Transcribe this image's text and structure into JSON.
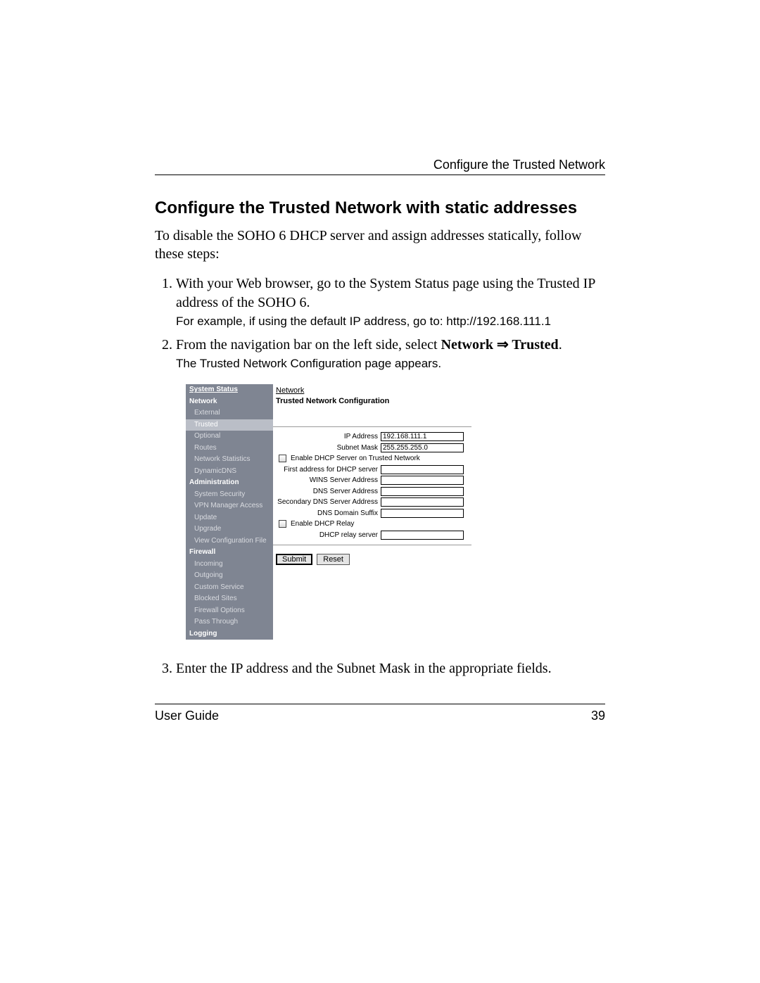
{
  "running_head": "Configure the Trusted Network",
  "section_title": "Configure the Trusted Network with static addresses",
  "intro": "To disable the SOHO 6 DHCP server and assign addresses statically, follow these steps:",
  "steps": {
    "1": {
      "main": "With your Web browser, go to the System Status page using the Trusted IP address of the SOHO 6.",
      "sub": "For example, if using the default IP address, go to: http://192.168.111.1"
    },
    "2": {
      "main_pre": "From the navigation bar on the left side, select ",
      "path": "Network ⇒ Trusted",
      "path_suffix": ".",
      "sub": "The Trusted Network Configuration page appears."
    },
    "3": {
      "main": "Enter the IP address and the Subnet Mask in the appropriate fields."
    }
  },
  "screenshot": {
    "sidebar": [
      {
        "label": "System Status",
        "type": "hdr",
        "underline": true
      },
      {
        "label": "Network",
        "type": "hdr"
      },
      {
        "label": "External",
        "type": "item"
      },
      {
        "label": "Trusted",
        "type": "item",
        "active": true
      },
      {
        "label": "Optional",
        "type": "item"
      },
      {
        "label": "Routes",
        "type": "item"
      },
      {
        "label": "Network Statistics",
        "type": "item"
      },
      {
        "label": "DynamicDNS",
        "type": "item"
      },
      {
        "label": "Administration",
        "type": "hdr"
      },
      {
        "label": "System Security",
        "type": "item"
      },
      {
        "label": "VPN Manager Access",
        "type": "item"
      },
      {
        "label": "Update",
        "type": "item"
      },
      {
        "label": "Upgrade",
        "type": "item"
      },
      {
        "label": "View Configuration File",
        "type": "item"
      },
      {
        "label": "Firewall",
        "type": "hdr"
      },
      {
        "label": "Incoming",
        "type": "item"
      },
      {
        "label": "Outgoing",
        "type": "item"
      },
      {
        "label": "Custom Service",
        "type": "item"
      },
      {
        "label": "Blocked Sites",
        "type": "item"
      },
      {
        "label": "Firewall Options",
        "type": "item"
      },
      {
        "label": "Pass Through",
        "type": "item"
      },
      {
        "label": "Logging",
        "type": "hdr"
      }
    ],
    "breadcrumb": "Network",
    "page_title": "Trusted Network Configuration",
    "fields": {
      "ip_address": {
        "label": "IP Address",
        "value": "192.168.111.1"
      },
      "subnet_mask": {
        "label": "Subnet Mask",
        "value": "255.255.255.0"
      },
      "enable_dhcp_server": "Enable DHCP Server on Trusted Network",
      "first_address": {
        "label": "First address for DHCP server",
        "value": ""
      },
      "wins_server": {
        "label": "WINS Server Address",
        "value": ""
      },
      "dns_server": {
        "label": "DNS Server Address",
        "value": ""
      },
      "sec_dns_server": {
        "label": "Secondary DNS Server Address",
        "value": ""
      },
      "dns_suffix": {
        "label": "DNS Domain Suffix",
        "value": ""
      },
      "enable_dhcp_relay": "Enable DHCP Relay",
      "dhcp_relay_server": {
        "label": "DHCP relay server",
        "value": ""
      }
    },
    "buttons": {
      "submit": "Submit",
      "reset": "Reset"
    }
  },
  "footer": {
    "left": "User Guide",
    "right": "39"
  }
}
